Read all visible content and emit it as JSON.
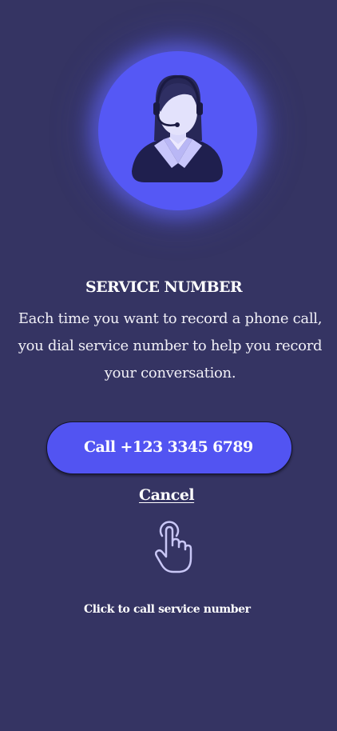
{
  "service": {
    "title": "SERVICE NUMBER",
    "description": "Each time you want to record a phone call, you dial service number to help you record your conversation."
  },
  "actions": {
    "call_label": "Call +123 3345 6789",
    "cancel_label": "Cancel"
  },
  "hint": {
    "text": "Click to call service number"
  },
  "icons": {
    "avatar": "customer-support-agent-icon",
    "tap": "tap-hand-icon"
  },
  "colors": {
    "background": "#353463",
    "accent": "#5558f5",
    "text": "#ffffff",
    "icon_outline": "#c9c7f6"
  }
}
